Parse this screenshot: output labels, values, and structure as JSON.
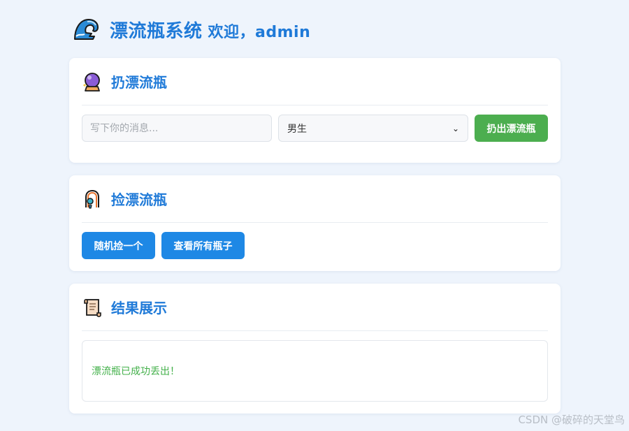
{
  "header": {
    "title": "漂流瓶系统",
    "welcome": "欢迎，admin",
    "logo_icon": "wave-icon"
  },
  "throw": {
    "heading": "扔漂流瓶",
    "icon": "crystal-ball-icon",
    "message_placeholder": "写下你的消息...",
    "message_value": "",
    "gender_selected": "男生",
    "throw_button": "扔出漂流瓶"
  },
  "pick": {
    "heading": "捡漂流瓶",
    "icon": "pick-icon",
    "random_button": "随机捡一个",
    "all_button": "查看所有瓶子"
  },
  "result": {
    "heading": "结果展示",
    "icon": "scroll-icon",
    "message": "漂流瓶已成功丢出！"
  },
  "watermark": "CSDN @破碎的天堂鸟",
  "colors": {
    "primary": "#1f7ad8",
    "success_button": "#4cae4f",
    "action_button": "#1e88e5",
    "success_text": "#43b04a",
    "background": "#eef4fc"
  }
}
